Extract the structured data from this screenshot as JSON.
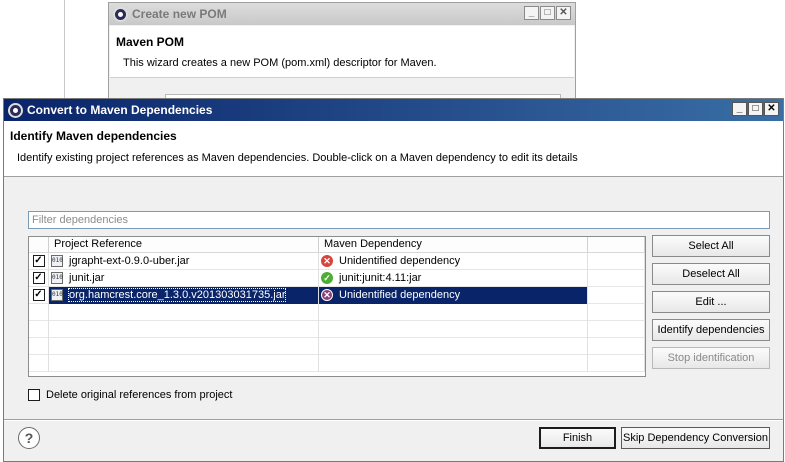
{
  "background_dialog": {
    "title": "Create new POM",
    "heading": "Maven POM",
    "description": "This wizard creates a new POM (pom.xml) descriptor for Maven."
  },
  "dialog": {
    "title": "Convert to Maven Dependencies",
    "heading": "Identify Maven dependencies",
    "description": "Identify existing project references as Maven dependencies. Double-click on a Maven dependency to edit its details"
  },
  "window_controls": {
    "minimize": "_",
    "maximize": "□",
    "close": "✕"
  },
  "filter": {
    "placeholder": "Filter dependencies",
    "value": ""
  },
  "table": {
    "columns": [
      "Project Reference",
      "Maven Dependency"
    ],
    "rows": [
      {
        "checked": true,
        "reference": "jgrapht-ext-0.9.0-uber.jar",
        "dependency": "Unidentified dependency",
        "status_icon": "error-icon",
        "selected": false
      },
      {
        "checked": true,
        "reference": "junit.jar",
        "dependency": "junit:junit:4.11:jar",
        "status_icon": "check-icon",
        "selected": false
      },
      {
        "checked": true,
        "reference": "org.hamcrest.core_1.3.0.v201303031735.jar",
        "dependency": "Unidentified dependency",
        "status_icon": "error-icon",
        "selected": true
      }
    ]
  },
  "buttons": {
    "select_all": "Select All",
    "deselect_all": "Deselect All",
    "edit": "Edit ...",
    "identify": "Identify dependencies",
    "stop": "Stop identification",
    "finish": "Finish",
    "skip": "Skip Dependency Conversion"
  },
  "delete_option": {
    "label": "Delete original references from project",
    "checked": false
  },
  "help": {
    "glyph": "?"
  },
  "colors": {
    "titlebar_start": "#0a246a",
    "titlebar_end": "#3a6ea5",
    "selection": "#0a246a",
    "error": "#d6453d",
    "ok": "#4cae34"
  }
}
